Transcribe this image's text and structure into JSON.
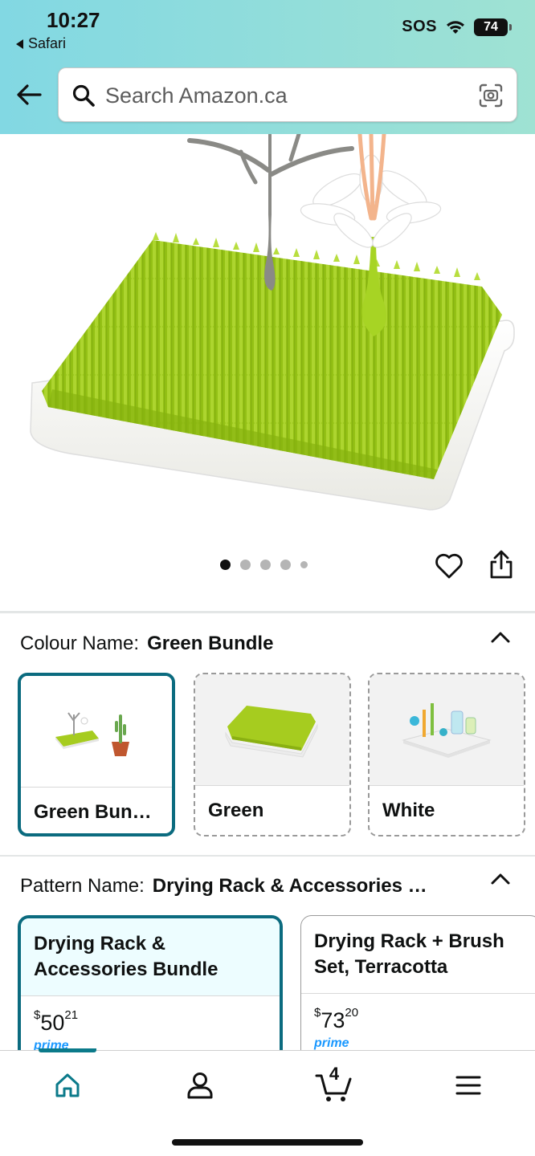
{
  "status_bar": {
    "time": "10:27",
    "back_app": "Safari",
    "sos": "SOS",
    "battery": "74"
  },
  "search": {
    "placeholder": "Search Amazon.ca"
  },
  "product_gallery": {
    "image_count": 5,
    "active_index": 0
  },
  "colour": {
    "label": "Colour Name:",
    "selected": "Green Bundle",
    "options": [
      {
        "label": "Green Bun…"
      },
      {
        "label": "Green"
      },
      {
        "label": "White"
      }
    ]
  },
  "pattern": {
    "label": "Pattern Name:",
    "selected": "Drying Rack & Accessories …",
    "options": [
      {
        "title_line1": "Drying Rack &",
        "title_line2": "Accessories Bundle",
        "price_currency": "$",
        "price_whole": "50",
        "price_fraction": "21",
        "badge": "prime"
      },
      {
        "title_line1": "Drying Rack + Brush",
        "title_line2": "Set, Terracotta",
        "price_currency": "$",
        "price_whole": "73",
        "price_fraction": "20",
        "badge": "prime"
      }
    ]
  },
  "bottom_nav": {
    "cart_count": "4",
    "items": [
      "home",
      "account",
      "cart",
      "menu"
    ]
  },
  "colors": {
    "header_gradient_start": "#82d8e3",
    "header_gradient_end": "#9fe2d3",
    "selected_border": "#0b6b7f",
    "prime_blue": "#1a98ff",
    "grass_green": "#9dc81e"
  }
}
